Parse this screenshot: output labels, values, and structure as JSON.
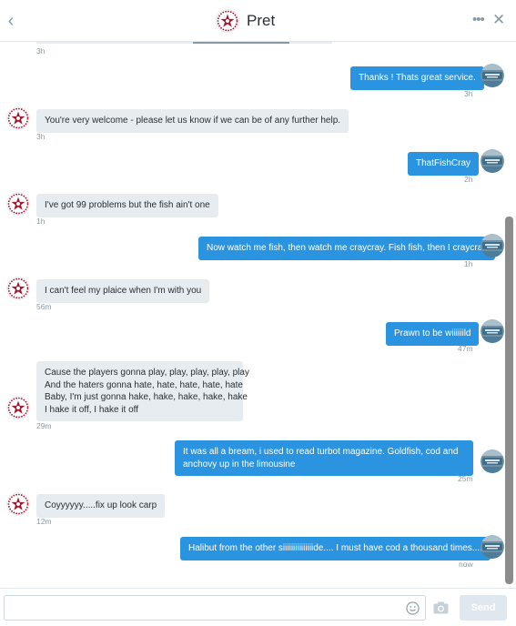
{
  "header": {
    "title": "Pret",
    "back_icon": "chevron-left-icon",
    "more_icon": "more-dots-icon",
    "close_icon": "close-icon",
    "back_glyph": "‹",
    "more_glyph": "•••",
    "close_glyph": "✕"
  },
  "conversation": {
    "first_time": "3h",
    "messages": [
      {
        "direction": "out",
        "text": "Thanks ! Thats great service.",
        "time": "3h"
      },
      {
        "direction": "in",
        "text": "You're very welcome - please let us know if we can be of any further help.",
        "time": "3h"
      },
      {
        "direction": "out",
        "text": "ThatFishCray",
        "time": "2h"
      },
      {
        "direction": "in",
        "text": "I've got 99 problems but the fish ain't one",
        "time": "1h"
      },
      {
        "direction": "out",
        "text": "Now watch me fish, then watch me craycray. Fish fish, then I craycray",
        "time": "1h"
      },
      {
        "direction": "in",
        "text": "I can't feel my plaice when I'm with you",
        "time": "56m"
      },
      {
        "direction": "out",
        "text": "Prawn to be wiiiiiild",
        "time": "47m"
      },
      {
        "direction": "in",
        "text": "Cause the players gonna play, play, play, play, play",
        "line2": "And the haters gonna hate, hate, hate, hate, hate",
        "line3": "Baby, I'm just gonna hake, hake, hake, hake, hake",
        "line4": "I hake it off, I hake it off",
        "time": "29m"
      },
      {
        "direction": "out",
        "text": "It was all a bream, i used to read turbot magazine. Goldfish, cod and anchovy up in the limousine",
        "time": "25m"
      },
      {
        "direction": "in",
        "text": "Coyyyyyy.....fix up look carp",
        "time": "12m"
      },
      {
        "direction": "out",
        "text": "Halibut from the other siiiiiiiiiiiiiiide.... I must have cod a thousand times....",
        "time": "now"
      }
    ]
  },
  "composer": {
    "input_value": "",
    "input_placeholder": "",
    "emoji_icon": "smiley-icon",
    "camera_icon": "camera-icon",
    "send_label": "Send"
  },
  "colors": {
    "accent": "#2b94e1",
    "incoming_bubble": "#e6ecf0",
    "timestamp": "#8899a6",
    "pret_red": "#a5162d"
  }
}
